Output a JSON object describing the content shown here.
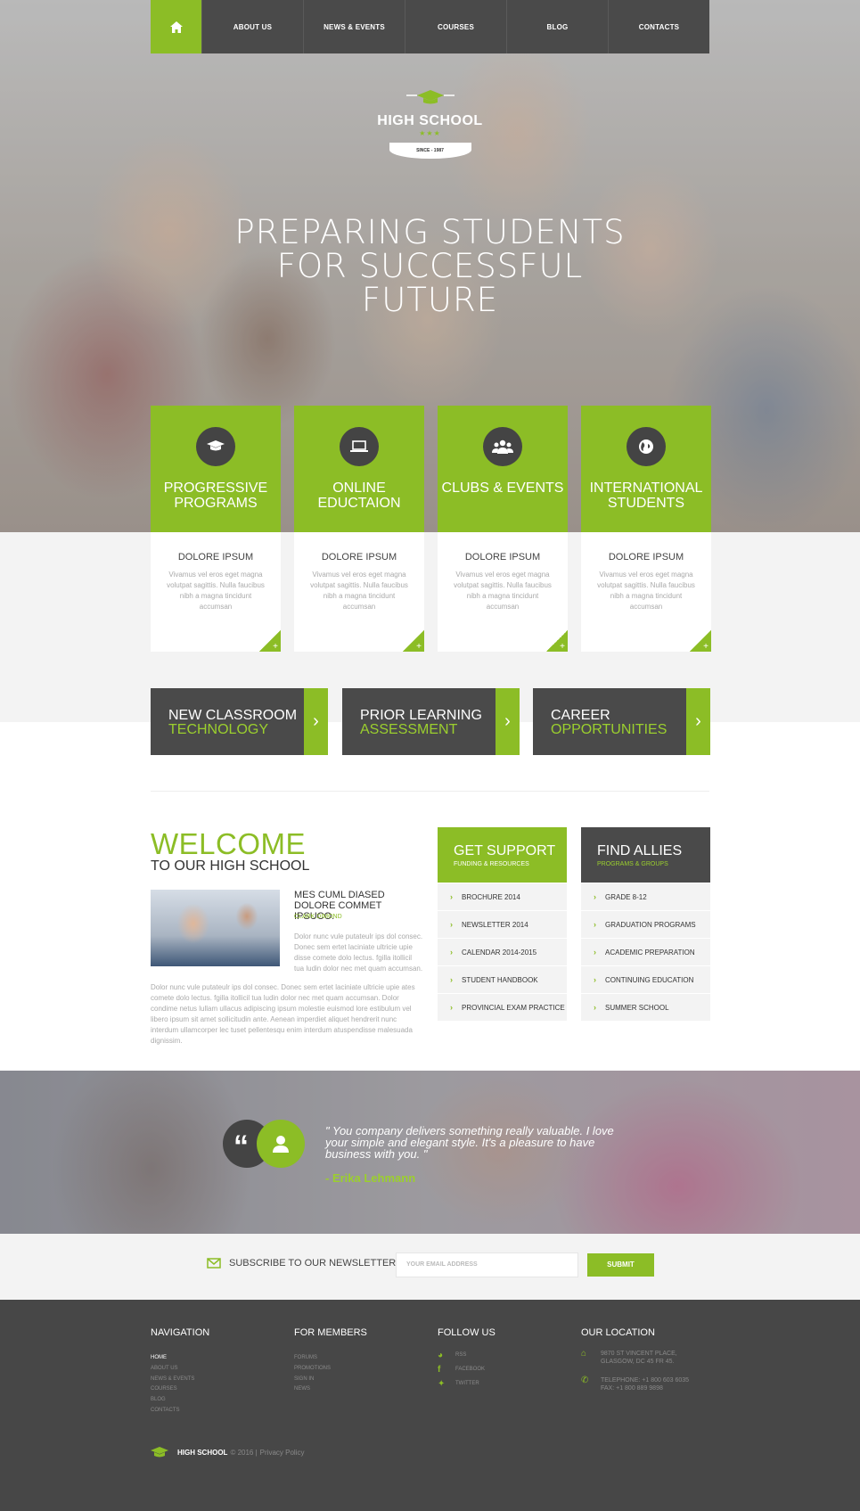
{
  "nav": {
    "items": [
      "ABOUT US",
      "NEWS & EVENTS",
      "COURSES",
      "BLOG",
      "CONTACTS"
    ]
  },
  "logo": {
    "name": "HIGH SCHOOL",
    "since": "SINCE - 1987"
  },
  "hero": {
    "headline": "PREPARING STUDENTS FOR SUCCESSFUL FUTURE"
  },
  "features": [
    {
      "title": "PROGRESSIVE PROGRAMS",
      "icon": "graduation-cap-icon",
      "subtitle": "DOLORE IPSUM",
      "text": "Vivamus vel eros eget magna volutpat sagittis. Nulla faucibus nibh a magna tincidunt accumsan"
    },
    {
      "title": "ONLINE EDUCTAION",
      "icon": "laptop-icon",
      "subtitle": "DOLORE IPSUM",
      "text": "Vivamus vel eros eget magna volutpat sagittis. Nulla faucibus nibh a magna tincidunt accumsan"
    },
    {
      "title": "CLUBS & EVENTS",
      "icon": "group-icon",
      "subtitle": "DOLORE IPSUM",
      "text": "Vivamus vel eros eget magna volutpat sagittis. Nulla faucibus nibh a magna tincidunt accumsan"
    },
    {
      "title": "INTERNATIONAL STUDENTS",
      "icon": "globe-icon",
      "subtitle": "DOLORE IPSUM",
      "text": "Vivamus vel eros eget magna volutpat sagittis. Nulla faucibus nibh a magna tincidunt accumsan"
    }
  ],
  "promos": [
    {
      "line1": "NEW CLASSROOM",
      "line2": "TECHNOLOGY"
    },
    {
      "line1": "PRIOR LEARNING",
      "line2": "ASSESSMENT"
    },
    {
      "line1": "CAREER",
      "line2": "OPPORTUNITIES"
    }
  ],
  "welcome": {
    "title": "WELCOME",
    "subtitle": "TO OUR HIGH SCHOOL",
    "quote_heading": "MES CUML DIASED DOLORE COMMET IPSUCO.",
    "quote_author": "CLARK DIMOND",
    "quote_text": "Dolor nunc vule putateulr ips dol consec. Donec sem ertet laciniate ultricie upie disse comete dolo lectus. fgilla itollicil tua ludin dolor nec met quam accumsan.",
    "body_text": "Dolor nunc vule putateulr ips dol consec. Donec sem ertet laciniate ultricie upie ates comete dolo lectus. fgilla itollicil tua ludin dolor nec met quam accumsan. Dolor condime netus lullam ullacus adipiscing ipsum molestie euismod lore estibulum vel libero ipsum sit amet sollicitudin ante. Aenean imperdiet aliquet hendrerit nunc interdum ullamcorper lec tuset pellentesqu enim interdum atuspendisse malesuada dignissim."
  },
  "support": {
    "title": "GET SUPPORT",
    "subtitle": "FUNDING & RESOURCES",
    "items": [
      "BROCHURE 2014",
      "NEWSLETTER 2014",
      "CALENDAR 2014-2015",
      "STUDENT HANDBOOK",
      "PROVINCIAL EXAM PRACTICE"
    ]
  },
  "allies": {
    "title": "FIND ALLIES",
    "subtitle": "PROGRAMS & GROUPS",
    "items": [
      "GRADE 8-12",
      "GRADUATION PROGRAMS",
      "ACADEMIC PREPARATION",
      "CONTINUING EDUCATION",
      "SUMMER SCHOOL"
    ]
  },
  "testimonial": {
    "text": "\" You company delivers something really valuable. I love your simple and elegant style. It's a pleasure to have business with you. \"",
    "author": "- Erika Lehmann"
  },
  "newsletter": {
    "label": "SUBSCRIBE TO OUR NEWSLETTER",
    "placeholder": "YOUR EMAIL ADDRESS",
    "button": "SUBMIT"
  },
  "footer": {
    "navigation": {
      "title": "NAVIGATION",
      "items": [
        "HOME",
        "ABOUT US",
        "NEWS & EVENTS",
        "COURSES",
        "BLOG",
        "CONTACTS"
      ]
    },
    "members": {
      "title": "FOR MEMBERS",
      "items": [
        "FORUMS",
        "PROMOTIONS",
        "SIGN IN",
        "NEWS"
      ]
    },
    "follow": {
      "title": "FOLLOW US",
      "items": [
        "RSS",
        "FACEBOOK",
        "TWITTER"
      ]
    },
    "location": {
      "title": "OUR LOCATION",
      "address": "9870 ST VINCENT PLACE, GLASGOW, DC 45 FR 45.",
      "phone": "TELEPHONE: +1 800 603 6035",
      "fax": "FAX: +1 800 889 9898"
    },
    "brand": "HIGH SCHOOL",
    "copyright": "© 2016 |",
    "privacy": "Privacy Policy"
  },
  "colors": {
    "accent": "#8cbd26",
    "dark": "#4a4a4a",
    "footer": "#474747"
  }
}
